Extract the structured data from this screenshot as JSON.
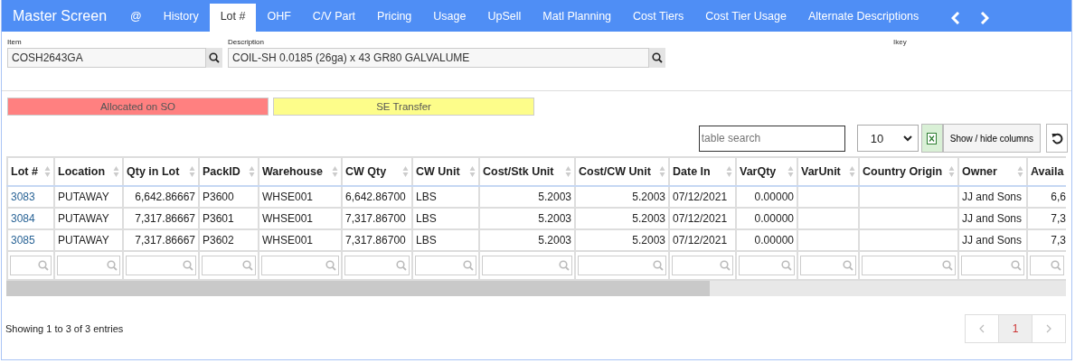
{
  "header": {
    "title": "Master Screen",
    "tabs": [
      {
        "label": "@",
        "selected": false
      },
      {
        "label": "History",
        "selected": false
      },
      {
        "label": "Lot #",
        "selected": true
      },
      {
        "label": "OHF",
        "selected": false
      },
      {
        "label": "C/V Part",
        "selected": false
      },
      {
        "label": "Pricing",
        "selected": false
      },
      {
        "label": "Usage",
        "selected": false
      },
      {
        "label": "UpSell",
        "selected": false
      },
      {
        "label": "Matl Planning",
        "selected": false
      },
      {
        "label": "Cost Tiers",
        "selected": false
      },
      {
        "label": "Cost Tier Usage",
        "selected": false
      },
      {
        "label": "Alternate Descriptions",
        "selected": false
      }
    ]
  },
  "fields": [
    {
      "label": "Item",
      "value": "COSH2643GA",
      "kind": "item"
    },
    {
      "label": "Description",
      "value": "COIL-SH 0.0185 (26ga) x 43 GR80 GALVALUME",
      "kind": "description"
    },
    {
      "label": "Ikey",
      "kind": "label"
    }
  ],
  "legend": [
    {
      "label": "Allocated on SO",
      "color": "#ff8080"
    },
    {
      "label": "SE Transfer",
      "color": "#fdfd8a"
    }
  ],
  "toolbar": {
    "search_placeholder": "table search",
    "page_size": "10",
    "columns_button": "Show / hide columns"
  },
  "table": {
    "columns": [
      {
        "label": "Lot #",
        "kind": "link"
      },
      {
        "label": "Location",
        "kind": "text"
      },
      {
        "label": "Qty in Lot",
        "kind": "number"
      },
      {
        "label": "PackID",
        "kind": "text"
      },
      {
        "label": "Warehouse",
        "kind": "text"
      },
      {
        "label": "CW Qty",
        "kind": "text"
      },
      {
        "label": "CW Unit",
        "kind": "text"
      },
      {
        "label": "Cost/Stk Unit",
        "kind": "number"
      },
      {
        "label": "Cost/CW Unit",
        "kind": "number"
      },
      {
        "label": "Date In",
        "kind": "text"
      },
      {
        "label": "VarQty",
        "kind": "number"
      },
      {
        "label": "VarUnit",
        "kind": "text"
      },
      {
        "label": "Country Origin",
        "kind": "text"
      },
      {
        "label": "Owner",
        "kind": "text"
      },
      {
        "label": "Availa",
        "kind": "number"
      }
    ],
    "rows": [
      [
        "3083",
        "PUTAWAY",
        "6,642.86667",
        "P3600",
        "WHSE001",
        "6,642.86700",
        "LBS",
        "5.2003",
        "5.2003",
        "07/12/2021",
        "0.00000",
        "",
        "",
        "JJ and Sons",
        "6,6"
      ],
      [
        "3084",
        "PUTAWAY",
        "7,317.86667",
        "P3601",
        "WHSE001",
        "7,317.86700",
        "LBS",
        "5.2003",
        "5.2003",
        "07/12/2021",
        "0.00000",
        "",
        "",
        "JJ and Sons",
        "7,3"
      ],
      [
        "3085",
        "PUTAWAY",
        "7,317.86667",
        "P3602",
        "WHSE001",
        "7,317.86700",
        "LBS",
        "5.2003",
        "5.2003",
        "07/12/2021",
        "0.00000",
        "",
        "",
        "JJ and Sons",
        "7,3"
      ]
    ]
  },
  "footer": {
    "info": "Showing 1 to 3 of 3 entries",
    "pages": [
      {
        "label": "1",
        "selected": true
      }
    ]
  }
}
